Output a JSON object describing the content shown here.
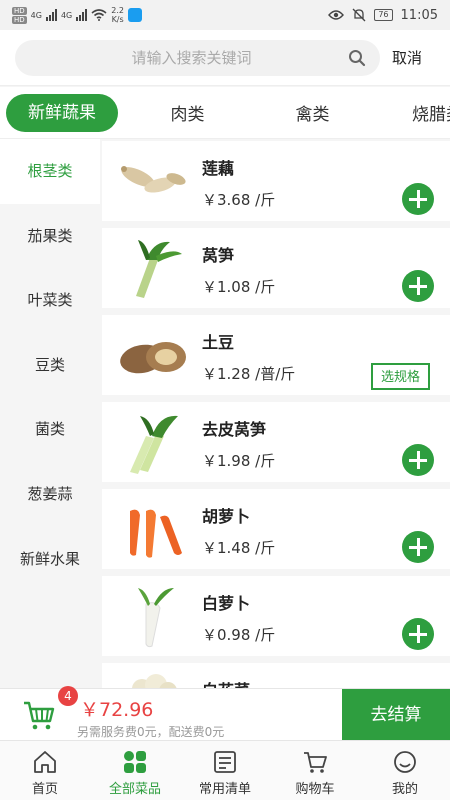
{
  "status_bar": {
    "net_speed": "2.2",
    "net_unit": "K/s",
    "signal_label": "4G",
    "battery": "76",
    "time": "11:05"
  },
  "search": {
    "placeholder": "请输入搜索关键词",
    "cancel_label": "取消"
  },
  "tabs": [
    "新鲜蔬果",
    "肉类",
    "禽类",
    "烧腊类"
  ],
  "active_tab": 0,
  "sidebar": {
    "items": [
      "根茎类",
      "茄果类",
      "叶菜类",
      "豆类",
      "菌类",
      "葱姜蒜",
      "新鲜水果"
    ],
    "active": 0
  },
  "products": [
    {
      "name": "莲藕",
      "price": "￥3.68 /斤",
      "action": "add",
      "image": "lotus-root"
    },
    {
      "name": "莴笋",
      "price": "￥1.08 /斤",
      "action": "add",
      "image": "lettuce-stem"
    },
    {
      "name": "土豆",
      "price": "￥1.28 /普/斤",
      "action": "spec",
      "spec_label": "选规格",
      "image": "potato"
    },
    {
      "name": "去皮莴笋",
      "price": "￥1.98 /斤",
      "action": "add",
      "image": "peeled-lettuce-stem"
    },
    {
      "name": "胡萝卜",
      "price": "￥1.48 /斤",
      "action": "add",
      "image": "carrot"
    },
    {
      "name": "白萝卜",
      "price": "￥0.98 /斤",
      "action": "add",
      "image": "white-radish"
    },
    {
      "name": "白花菜",
      "price": "",
      "action": "add",
      "image": "cauliflower"
    }
  ],
  "cart": {
    "count": "4",
    "total": "￥72.96",
    "note": "另需服务费0元，配送费0元",
    "checkout_label": "去结算"
  },
  "bottom_nav": {
    "items": [
      {
        "label": "首页",
        "icon": "home-icon"
      },
      {
        "label": "全部菜品",
        "icon": "grid-icon"
      },
      {
        "label": "常用清单",
        "icon": "list-icon"
      },
      {
        "label": "购物车",
        "icon": "cart-icon"
      },
      {
        "label": "我的",
        "icon": "profile-icon"
      }
    ],
    "active": 1
  },
  "colors": {
    "accent": "#2e9e3f",
    "price_red": "#e84343"
  }
}
